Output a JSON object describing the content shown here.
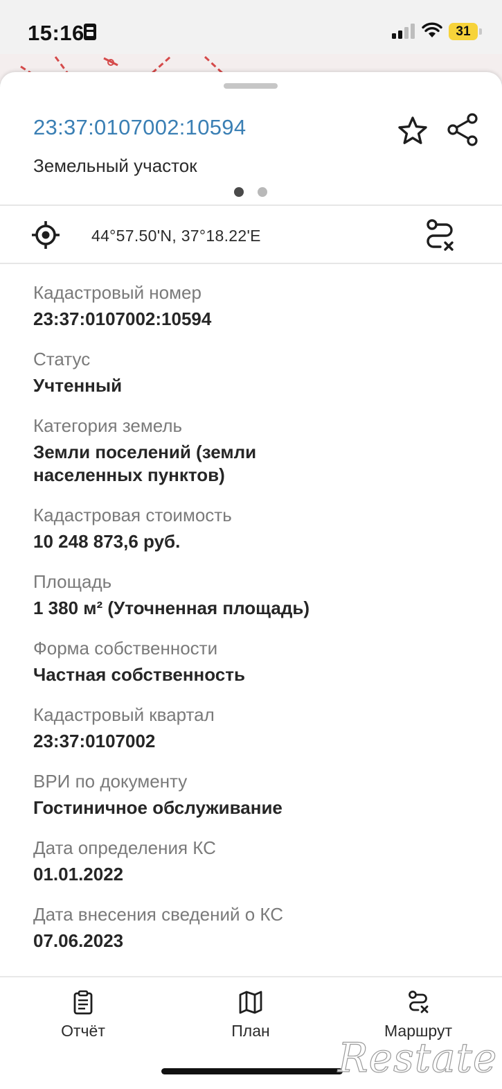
{
  "status_bar": {
    "time": "15:16",
    "battery": "31",
    "battery_color": "#f7d33a"
  },
  "header": {
    "cadastral_number": "23:37:0107002:10594",
    "object_type": "Земельный участок",
    "title_color": "#3a7fb4",
    "page_dots": {
      "count": 2,
      "active": 0
    },
    "icons": {
      "favorite": "star-icon",
      "share": "share-icon"
    }
  },
  "location": {
    "coords": "44°57.50'N, 37°18.22'E",
    "icons": {
      "locate": "crosshair-icon",
      "route": "route-icon"
    }
  },
  "properties": [
    {
      "label": "Кадастровый номер",
      "value": "23:37:0107002:10594"
    },
    {
      "label": "Статус",
      "value": "Учтенный"
    },
    {
      "label": "Категория земель",
      "value": "Земли поселений (земли\nнаселенных пунктов)"
    },
    {
      "label": "Кадастровая стоимость",
      "value": "10 248 873,6 руб."
    },
    {
      "label": "Площадь",
      "value": "1 380 м² (Уточненная площадь)"
    },
    {
      "label": "Форма собственности",
      "value": "Частная собственность"
    },
    {
      "label": "Кадастровый квартал",
      "value": "23:37:0107002"
    },
    {
      "label": "ВРИ по документу",
      "value": "Гостиничное обслуживание"
    },
    {
      "label": "Дата определения КС",
      "value": "01.01.2022"
    },
    {
      "label": "Дата внесения сведений о КС",
      "value": "07.06.2023"
    }
  ],
  "bottom_nav": {
    "report": {
      "label": "Отчёт",
      "icon": "clipboard-icon"
    },
    "plan": {
      "label": "План",
      "icon": "map-icon"
    },
    "route": {
      "label": "Маршрут",
      "icon": "route-icon"
    }
  },
  "watermark": "Restate"
}
